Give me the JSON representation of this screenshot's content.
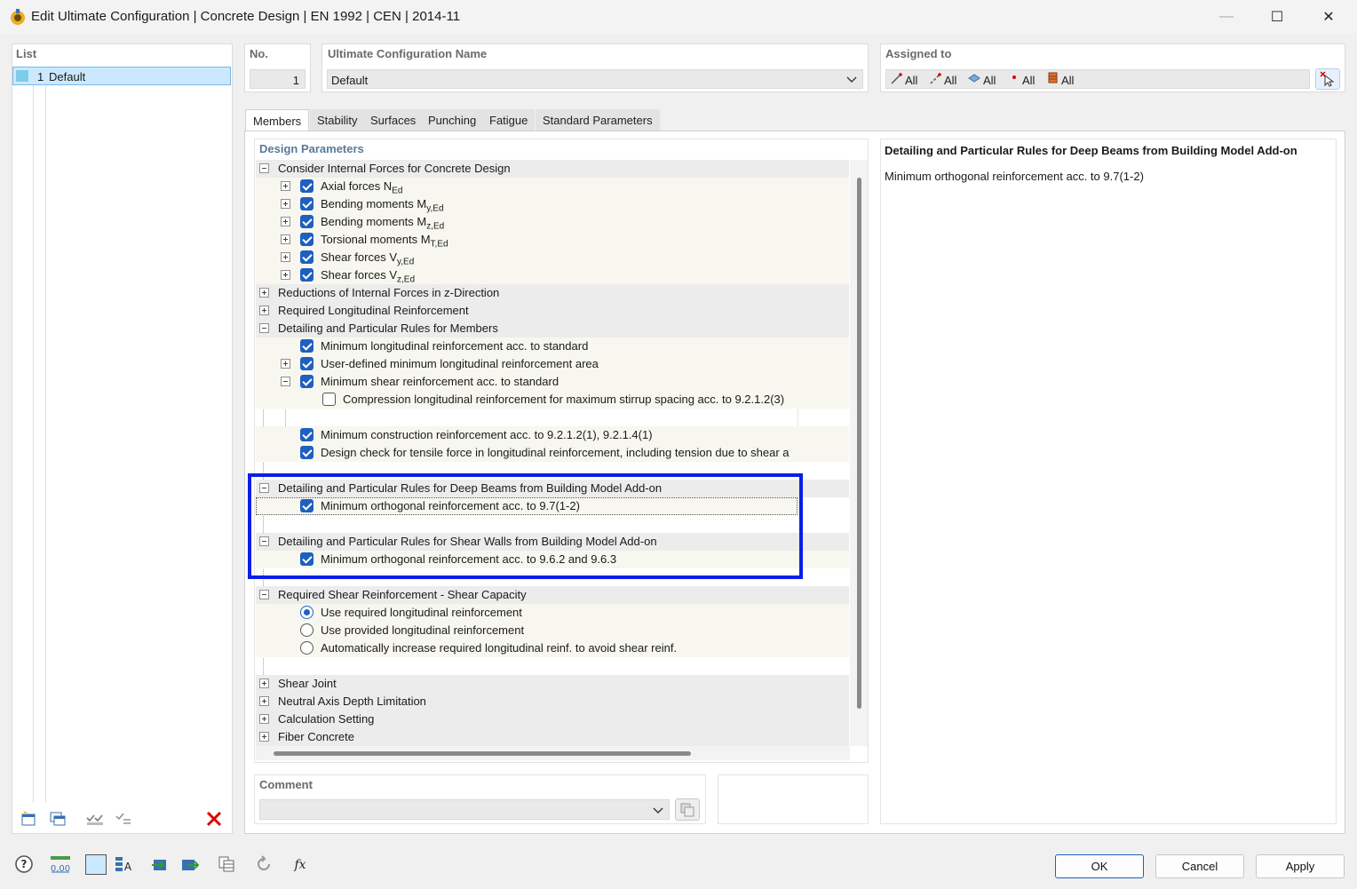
{
  "window": {
    "title": "Edit Ultimate Configuration | Concrete Design | EN 1992 | CEN | 2014-11",
    "minimize": "—",
    "maximize": "☐",
    "close": "✕"
  },
  "list": {
    "header": "List",
    "items": [
      {
        "number": "1",
        "name": "Default"
      }
    ]
  },
  "no": {
    "label": "No.",
    "value": "1"
  },
  "config_name": {
    "label": "Ultimate Configuration Name",
    "value": "Default"
  },
  "assigned": {
    "label": "Assigned to",
    "items": [
      "All",
      "All",
      "All",
      "All",
      "All"
    ]
  },
  "tabs": [
    "Members",
    "Stability",
    "Surfaces",
    "Punching",
    "Fatigue",
    "Standard Parameters"
  ],
  "design_params": {
    "header": "Design Parameters",
    "rows": [
      {
        "text": "Consider Internal Forces for Concrete Design"
      },
      {
        "text": "Axial forces N",
        "sub": "Ed"
      },
      {
        "text": "Bending moments M",
        "sub": "y,Ed"
      },
      {
        "text": "Bending moments M",
        "sub": "z,Ed"
      },
      {
        "text": "Torsional moments M",
        "sub": "T,Ed"
      },
      {
        "text": "Shear forces V",
        "sub": "y,Ed"
      },
      {
        "text": "Shear forces V",
        "sub": "z,Ed"
      },
      {
        "text": "Reductions of Internal Forces in z-Direction"
      },
      {
        "text": "Required Longitudinal Reinforcement"
      },
      {
        "text": "Detailing and Particular Rules for Members"
      },
      {
        "text": "Minimum longitudinal reinforcement acc. to standard"
      },
      {
        "text": "User-defined minimum longitudinal reinforcement area"
      },
      {
        "text": "Minimum shear reinforcement acc. to standard"
      },
      {
        "text": "Compression longitudinal reinforcement for maximum stirrup spacing acc. to 9.2.1.2(3)"
      },
      {
        "text": "Minimum construction reinforcement acc. to 9.2.1.2(1), 9.2.1.4(1)"
      },
      {
        "text": "Design check for tensile force in longitudinal reinforcement, including tension due to shear a"
      },
      {
        "text": "Detailing and Particular Rules for Deep Beams from Building Model Add-on"
      },
      {
        "text": "Minimum orthogonal reinforcement acc. to 9.7(1-2)"
      },
      {
        "text": "Detailing and Particular Rules for Shear Walls from Building Model Add-on"
      },
      {
        "text": "Minimum orthogonal reinforcement acc. to 9.6.2 and 9.6.3"
      },
      {
        "text": "Required Shear Reinforcement - Shear Capacity"
      },
      {
        "text": "Use required longitudinal reinforcement"
      },
      {
        "text": "Use provided longitudinal reinforcement"
      },
      {
        "text": "Automatically increase required longitudinal reinf. to avoid shear reinf."
      },
      {
        "text": "Shear Joint"
      },
      {
        "text": "Neutral Axis Depth Limitation"
      },
      {
        "text": "Calculation Setting"
      },
      {
        "text": "Fiber Concrete"
      }
    ]
  },
  "info": {
    "title": "Detailing and Particular Rules for Deep Beams from Building Model Add-on",
    "text": "Minimum orthogonal reinforcement acc. to 9.7(1-2)"
  },
  "comment": {
    "label": "Comment",
    "value": ""
  },
  "buttons": {
    "ok": "OK",
    "cancel": "Cancel",
    "apply": "Apply"
  },
  "colors": {
    "highlight_frame": "#0a1ee6",
    "checkbox": "#1f5fbf",
    "selection": "#cce8ff"
  }
}
